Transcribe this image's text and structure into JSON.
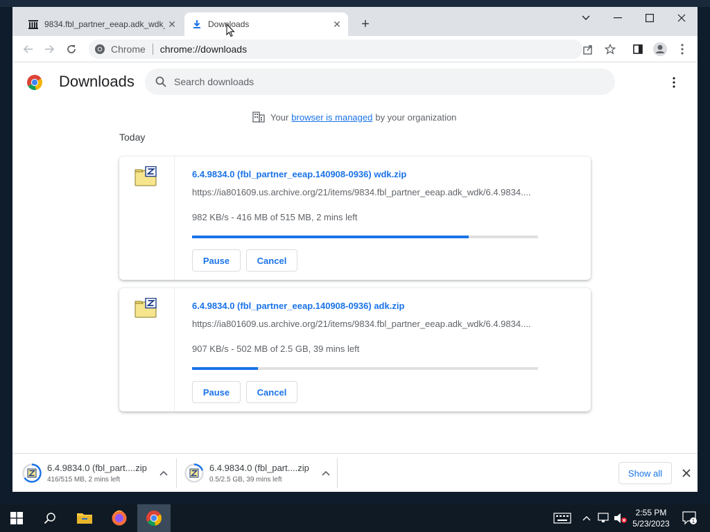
{
  "tabs": [
    {
      "title": "9834.fbl_partner_eeap.adk_wdk_c",
      "icon": "archive-icon"
    },
    {
      "title": "Downloads",
      "icon": "download-icon"
    }
  ],
  "omnibox": {
    "chip": "Chrome",
    "url": "chrome://downloads"
  },
  "page": {
    "title": "Downloads",
    "search_placeholder": "Search downloads",
    "managed_prefix": "Your",
    "managed_link": "browser is managed",
    "managed_suffix": "by your organization",
    "section": "Today"
  },
  "downloads": [
    {
      "name": "6.4.9834.0 (fbl_partner_eeap.140908-0936) wdk.zip",
      "url": "https://ia801609.us.archive.org/21/items/9834.fbl_partner_eeap.adk_wdk/6.4.9834....",
      "status": "982 KB/s - 416 MB of 515 MB, 2 mins left",
      "progress": 0.8,
      "pause_label": "Pause",
      "cancel_label": "Cancel"
    },
    {
      "name": "6.4.9834.0 (fbl_partner_eeap.140908-0936) adk.zip",
      "url": "https://ia801609.us.archive.org/21/items/9834.fbl_partner_eeap.adk_wdk/6.4.9834....",
      "status": "907 KB/s - 502 MB of 2.5 GB, 39 mins left",
      "progress": 0.19,
      "pause_label": "Pause",
      "cancel_label": "Cancel"
    }
  ],
  "shelf": {
    "items": [
      {
        "name": "6.4.9834.0 (fbl_part....zip",
        "status": "416/515 MB, 2 mins left"
      },
      {
        "name": "6.4.9834.0 (fbl_part....zip",
        "status": "0.5/2.5 GB, 39 mins left"
      }
    ],
    "show_all": "Show all"
  },
  "taskbar": {
    "time": "2:55 PM",
    "date": "5/23/2023",
    "notification_count": "1"
  },
  "colors": {
    "accent": "#1a73e8",
    "taskbar": "#101a24"
  }
}
